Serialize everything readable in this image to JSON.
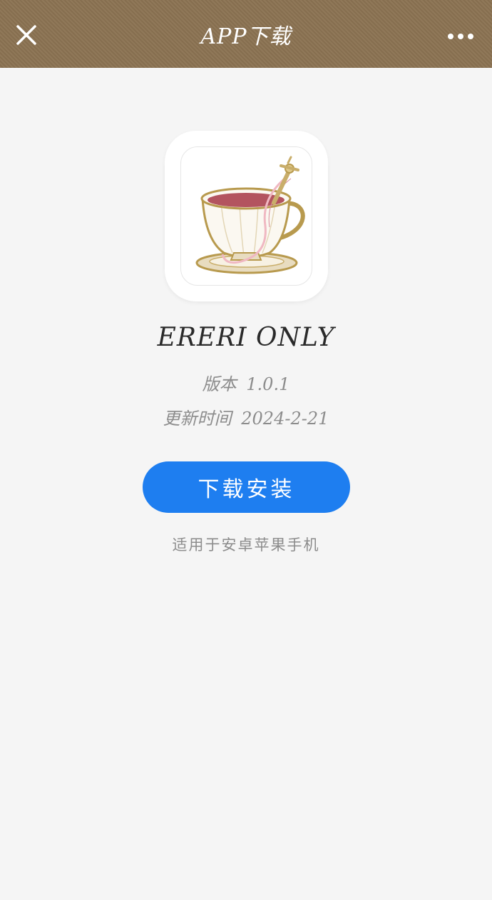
{
  "header": {
    "title": "APP下载",
    "close_icon": "close-icon",
    "more_icon": "more-dots-icon",
    "background_color": "#8b7352"
  },
  "app": {
    "icon": "teacup-app-icon",
    "name": "ERERI ONLY",
    "version_label": "版本",
    "version_value": "1.0.1",
    "update_label": "更新时间",
    "update_value": "2024-2-21"
  },
  "actions": {
    "download_label": "下载安装",
    "download_color": "#1e7ef0"
  },
  "footer": {
    "compat_note": "适用于安卓苹果手机"
  }
}
